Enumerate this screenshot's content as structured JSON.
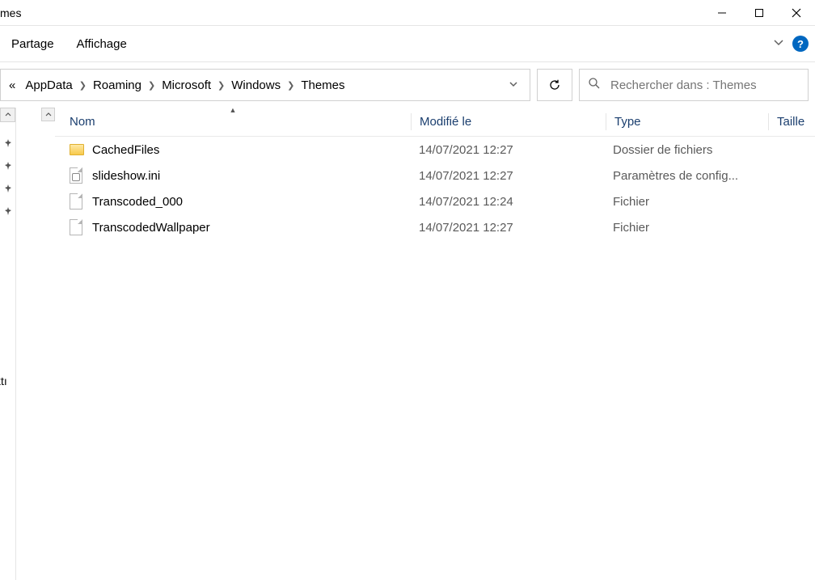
{
  "titlebar": {
    "title_fragment": "mes"
  },
  "ribbon": {
    "tabs": [
      {
        "label": "Partage"
      },
      {
        "label": "Affichage"
      }
    ]
  },
  "breadcrumb": {
    "overflow_marker": "«",
    "items": [
      {
        "label": "AppData"
      },
      {
        "label": "Roaming"
      },
      {
        "label": "Microsoft"
      },
      {
        "label": "Windows"
      },
      {
        "label": "Themes"
      }
    ]
  },
  "search": {
    "placeholder": "Rechercher dans : Themes"
  },
  "columns": {
    "name": "Nom",
    "modified": "Modifié le",
    "type": "Type",
    "size": "Taille"
  },
  "sidebar_fragment": "ktı",
  "files": [
    {
      "icon": "folder",
      "name": "CachedFiles",
      "modified": "14/07/2021 12:27",
      "type": "Dossier de fichiers"
    },
    {
      "icon": "ini",
      "name": "slideshow.ini",
      "modified": "14/07/2021 12:27",
      "type": "Paramètres de config..."
    },
    {
      "icon": "file",
      "name": "Transcoded_000",
      "modified": "14/07/2021 12:24",
      "type": "Fichier"
    },
    {
      "icon": "file",
      "name": "TranscodedWallpaper",
      "modified": "14/07/2021 12:27",
      "type": "Fichier"
    }
  ]
}
